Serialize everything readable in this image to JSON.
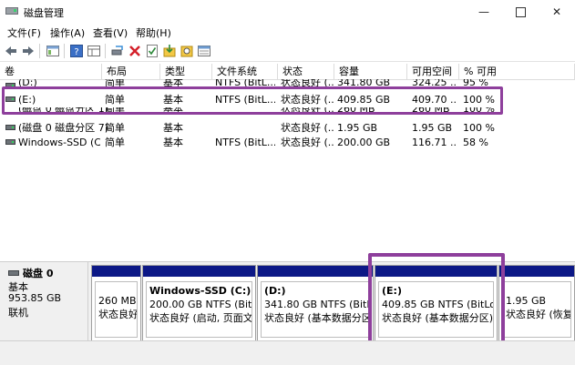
{
  "window": {
    "title": "磁盘管理",
    "min_glyph": "—",
    "close_glyph": "✕"
  },
  "menu": [
    "文件(F)",
    "操作(A)",
    "查看(V)",
    "帮助(H)"
  ],
  "toolbar_icons": [
    "back-arrow-icon",
    "forward-arrow-icon",
    "console-tree-icon",
    "help-icon",
    "properties-grid-icon",
    "connect-icon",
    "delete-icon",
    "check-icon",
    "import-icon",
    "search-icon",
    "view-icon"
  ],
  "columns": [
    "卷",
    "布局",
    "类型",
    "文件系统",
    "状态",
    "容量",
    "可用空间",
    "% 可用"
  ],
  "volumes": [
    {
      "name": "(D:)",
      "layout": "简单",
      "type": "基本",
      "fs": "NTFS (BitL...",
      "status": "状态良好 (...",
      "capacity": "341.80 GB",
      "free": "324.25 ...",
      "pct": "95 %"
    },
    {
      "name": "(E:)",
      "layout": "简单",
      "type": "基本",
      "fs": "NTFS (BitL...",
      "status": "状态良好 (...",
      "capacity": "409.85 GB",
      "free": "409.70 ...",
      "pct": "100 %"
    },
    {
      "name": "(磁盘 0 磁盘分区 1)",
      "layout": "简单",
      "type": "基本",
      "fs": "",
      "status": "状态良好 (...",
      "capacity": "260 MB",
      "free": "260 MB",
      "pct": "100 %"
    },
    {
      "name": "(磁盘 0 磁盘分区 7)",
      "layout": "简单",
      "type": "基本",
      "fs": "",
      "status": "状态良好 (...",
      "capacity": "1.95 GB",
      "free": "1.95 GB",
      "pct": "100 %"
    },
    {
      "name": "Windows-SSD (C:)",
      "layout": "简单",
      "type": "基本",
      "fs": "NTFS (BitL...",
      "status": "状态良好 (...",
      "capacity": "200.00 GB",
      "free": "116.71 ...",
      "pct": "58 %"
    }
  ],
  "disk": {
    "name": "磁盘 0",
    "type": "基本",
    "size": "953.85 GB",
    "state": "联机"
  },
  "partitions": [
    {
      "name": "",
      "size": "260 MB",
      "status": "状态良好"
    },
    {
      "name": "Windows-SSD  (C:)",
      "size": "200.00 GB NTFS (BitLocke",
      "status": "状态良好 (启动, 页面文件"
    },
    {
      "name": "(D:)",
      "size": "341.80 GB NTFS (BitLocke",
      "status": "状态良好 (基本数据分区)"
    },
    {
      "name": "(E:)",
      "size": "409.85 GB NTFS (BitLocke",
      "status": "状态良好 (基本数据分区)"
    },
    {
      "name": "",
      "size": "1.95 GB",
      "status": "状态良好 (恢复"
    }
  ],
  "colors": {
    "primary_partition_bar": "#0c1886",
    "highlight": "#8e3f9c"
  }
}
